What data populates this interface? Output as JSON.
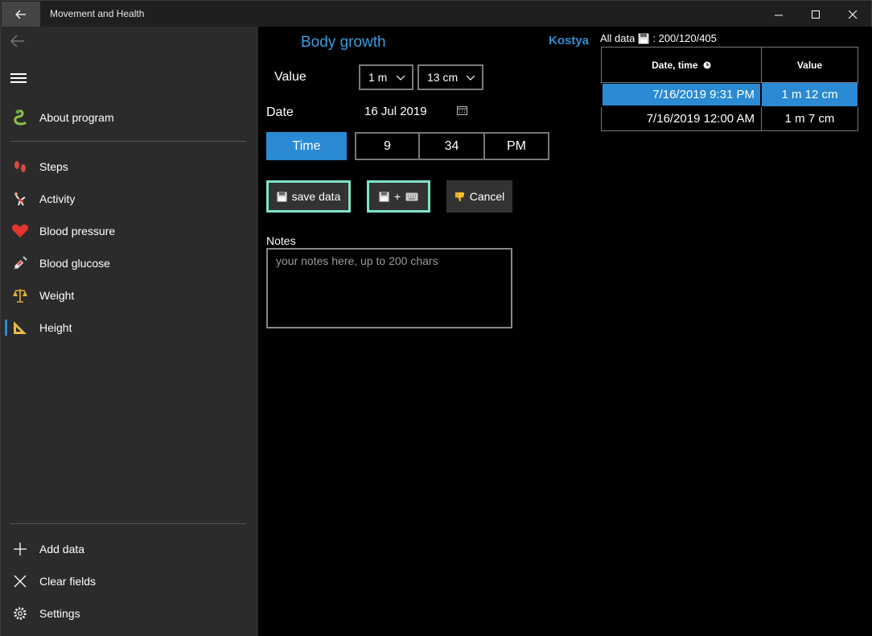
{
  "window": {
    "title": "Movement and Health"
  },
  "sidebar": {
    "items": [
      {
        "label": "About program",
        "icon": "snake-icon"
      },
      {
        "label": "Steps",
        "icon": "footprints-icon"
      },
      {
        "label": "Activity",
        "icon": "gymnast-icon"
      },
      {
        "label": "Blood pressure",
        "icon": "heart-icon"
      },
      {
        "label": "Blood glucose",
        "icon": "syringe-icon"
      },
      {
        "label": "Weight",
        "icon": "scales-icon"
      },
      {
        "label": "Height",
        "icon": "triangle-ruler-icon",
        "selected": true
      }
    ],
    "bottom_items": [
      {
        "label": "Add data",
        "icon": "plus-icon"
      },
      {
        "label": "Clear fields",
        "icon": "close-icon"
      },
      {
        "label": "Settings",
        "icon": "gear-icon"
      }
    ]
  },
  "main": {
    "title": "Body growth",
    "user": "Kostya",
    "alldata_label": "All data",
    "alldata_counts": ": 200/120/405",
    "value_label": "Value",
    "meters_value": "1 m",
    "centimeters_value": "13 cm",
    "date_label": "Date",
    "date_value": "16 Jul 2019",
    "time_button": "Time",
    "hour": "9",
    "minute": "34",
    "ampm": "PM",
    "save_label": "save data",
    "save_plus_label": "+",
    "cancel_label": "Cancel",
    "notes_label": "Notes",
    "notes_placeholder": "your notes here, up to 200 chars",
    "notes_value": ""
  },
  "table": {
    "headers": {
      "date": "Date, time",
      "value": "Value"
    },
    "rows": [
      {
        "date": "7/16/2019 9:31 PM",
        "value": "1 m 12 cm",
        "selected": true
      },
      {
        "date": "7/16/2019 12:00 AM",
        "value": "1 m 7 cm",
        "selected": false
      }
    ]
  },
  "colors": {
    "accent": "#2a8ad4",
    "button_outline": "#7de3c8",
    "sidebar_bg": "#2b2b2b",
    "title_blue": "#3a9de0"
  }
}
